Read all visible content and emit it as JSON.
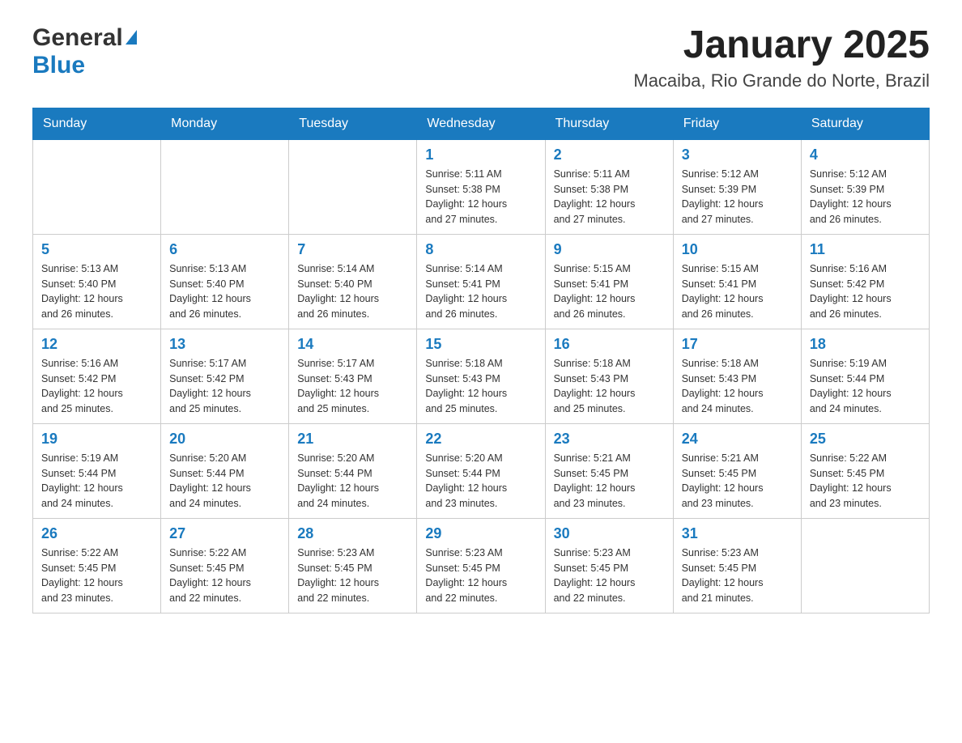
{
  "logo": {
    "text_general": "General",
    "text_blue": "Blue"
  },
  "header": {
    "title": "January 2025",
    "subtitle": "Macaiba, Rio Grande do Norte, Brazil"
  },
  "days_of_week": [
    "Sunday",
    "Monday",
    "Tuesday",
    "Wednesday",
    "Thursday",
    "Friday",
    "Saturday"
  ],
  "weeks": [
    [
      {
        "day": "",
        "info": ""
      },
      {
        "day": "",
        "info": ""
      },
      {
        "day": "",
        "info": ""
      },
      {
        "day": "1",
        "info": "Sunrise: 5:11 AM\nSunset: 5:38 PM\nDaylight: 12 hours\nand 27 minutes."
      },
      {
        "day": "2",
        "info": "Sunrise: 5:11 AM\nSunset: 5:38 PM\nDaylight: 12 hours\nand 27 minutes."
      },
      {
        "day": "3",
        "info": "Sunrise: 5:12 AM\nSunset: 5:39 PM\nDaylight: 12 hours\nand 27 minutes."
      },
      {
        "day": "4",
        "info": "Sunrise: 5:12 AM\nSunset: 5:39 PM\nDaylight: 12 hours\nand 26 minutes."
      }
    ],
    [
      {
        "day": "5",
        "info": "Sunrise: 5:13 AM\nSunset: 5:40 PM\nDaylight: 12 hours\nand 26 minutes."
      },
      {
        "day": "6",
        "info": "Sunrise: 5:13 AM\nSunset: 5:40 PM\nDaylight: 12 hours\nand 26 minutes."
      },
      {
        "day": "7",
        "info": "Sunrise: 5:14 AM\nSunset: 5:40 PM\nDaylight: 12 hours\nand 26 minutes."
      },
      {
        "day": "8",
        "info": "Sunrise: 5:14 AM\nSunset: 5:41 PM\nDaylight: 12 hours\nand 26 minutes."
      },
      {
        "day": "9",
        "info": "Sunrise: 5:15 AM\nSunset: 5:41 PM\nDaylight: 12 hours\nand 26 minutes."
      },
      {
        "day": "10",
        "info": "Sunrise: 5:15 AM\nSunset: 5:41 PM\nDaylight: 12 hours\nand 26 minutes."
      },
      {
        "day": "11",
        "info": "Sunrise: 5:16 AM\nSunset: 5:42 PM\nDaylight: 12 hours\nand 26 minutes."
      }
    ],
    [
      {
        "day": "12",
        "info": "Sunrise: 5:16 AM\nSunset: 5:42 PM\nDaylight: 12 hours\nand 25 minutes."
      },
      {
        "day": "13",
        "info": "Sunrise: 5:17 AM\nSunset: 5:42 PM\nDaylight: 12 hours\nand 25 minutes."
      },
      {
        "day": "14",
        "info": "Sunrise: 5:17 AM\nSunset: 5:43 PM\nDaylight: 12 hours\nand 25 minutes."
      },
      {
        "day": "15",
        "info": "Sunrise: 5:18 AM\nSunset: 5:43 PM\nDaylight: 12 hours\nand 25 minutes."
      },
      {
        "day": "16",
        "info": "Sunrise: 5:18 AM\nSunset: 5:43 PM\nDaylight: 12 hours\nand 25 minutes."
      },
      {
        "day": "17",
        "info": "Sunrise: 5:18 AM\nSunset: 5:43 PM\nDaylight: 12 hours\nand 24 minutes."
      },
      {
        "day": "18",
        "info": "Sunrise: 5:19 AM\nSunset: 5:44 PM\nDaylight: 12 hours\nand 24 minutes."
      }
    ],
    [
      {
        "day": "19",
        "info": "Sunrise: 5:19 AM\nSunset: 5:44 PM\nDaylight: 12 hours\nand 24 minutes."
      },
      {
        "day": "20",
        "info": "Sunrise: 5:20 AM\nSunset: 5:44 PM\nDaylight: 12 hours\nand 24 minutes."
      },
      {
        "day": "21",
        "info": "Sunrise: 5:20 AM\nSunset: 5:44 PM\nDaylight: 12 hours\nand 24 minutes."
      },
      {
        "day": "22",
        "info": "Sunrise: 5:20 AM\nSunset: 5:44 PM\nDaylight: 12 hours\nand 23 minutes."
      },
      {
        "day": "23",
        "info": "Sunrise: 5:21 AM\nSunset: 5:45 PM\nDaylight: 12 hours\nand 23 minutes."
      },
      {
        "day": "24",
        "info": "Sunrise: 5:21 AM\nSunset: 5:45 PM\nDaylight: 12 hours\nand 23 minutes."
      },
      {
        "day": "25",
        "info": "Sunrise: 5:22 AM\nSunset: 5:45 PM\nDaylight: 12 hours\nand 23 minutes."
      }
    ],
    [
      {
        "day": "26",
        "info": "Sunrise: 5:22 AM\nSunset: 5:45 PM\nDaylight: 12 hours\nand 23 minutes."
      },
      {
        "day": "27",
        "info": "Sunrise: 5:22 AM\nSunset: 5:45 PM\nDaylight: 12 hours\nand 22 minutes."
      },
      {
        "day": "28",
        "info": "Sunrise: 5:23 AM\nSunset: 5:45 PM\nDaylight: 12 hours\nand 22 minutes."
      },
      {
        "day": "29",
        "info": "Sunrise: 5:23 AM\nSunset: 5:45 PM\nDaylight: 12 hours\nand 22 minutes."
      },
      {
        "day": "30",
        "info": "Sunrise: 5:23 AM\nSunset: 5:45 PM\nDaylight: 12 hours\nand 22 minutes."
      },
      {
        "day": "31",
        "info": "Sunrise: 5:23 AM\nSunset: 5:45 PM\nDaylight: 12 hours\nand 21 minutes."
      },
      {
        "day": "",
        "info": ""
      }
    ]
  ]
}
